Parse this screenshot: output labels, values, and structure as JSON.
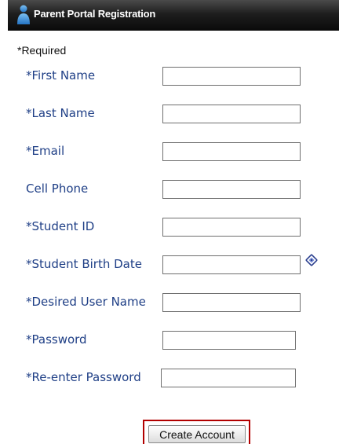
{
  "header": {
    "title": "Parent Portal Registration",
    "icon": "user-icon"
  },
  "form": {
    "required_note": "*Required",
    "fields": {
      "first_name": {
        "label": "*First Name",
        "value": ""
      },
      "last_name": {
        "label": "*Last Name",
        "value": ""
      },
      "email": {
        "label": "*Email",
        "value": ""
      },
      "cell_phone": {
        "label": "Cell Phone",
        "value": ""
      },
      "student_id": {
        "label": "*Student ID",
        "value": ""
      },
      "birth_date": {
        "label": "*Student Birth Date",
        "value": "",
        "picker_icon": "calendar-icon"
      },
      "user_name": {
        "label": "*Desired User Name",
        "value": ""
      },
      "password": {
        "label": "*Password",
        "value": ""
      },
      "reenter_password": {
        "label": "*Re-enter Password",
        "value": ""
      }
    },
    "submit_label": "Create Account"
  },
  "colors": {
    "label_blue": "#1f3f86",
    "highlight_red": "#b20000",
    "header_dark": "#0a0a0a",
    "icon_blue": "#3b8fd9"
  }
}
